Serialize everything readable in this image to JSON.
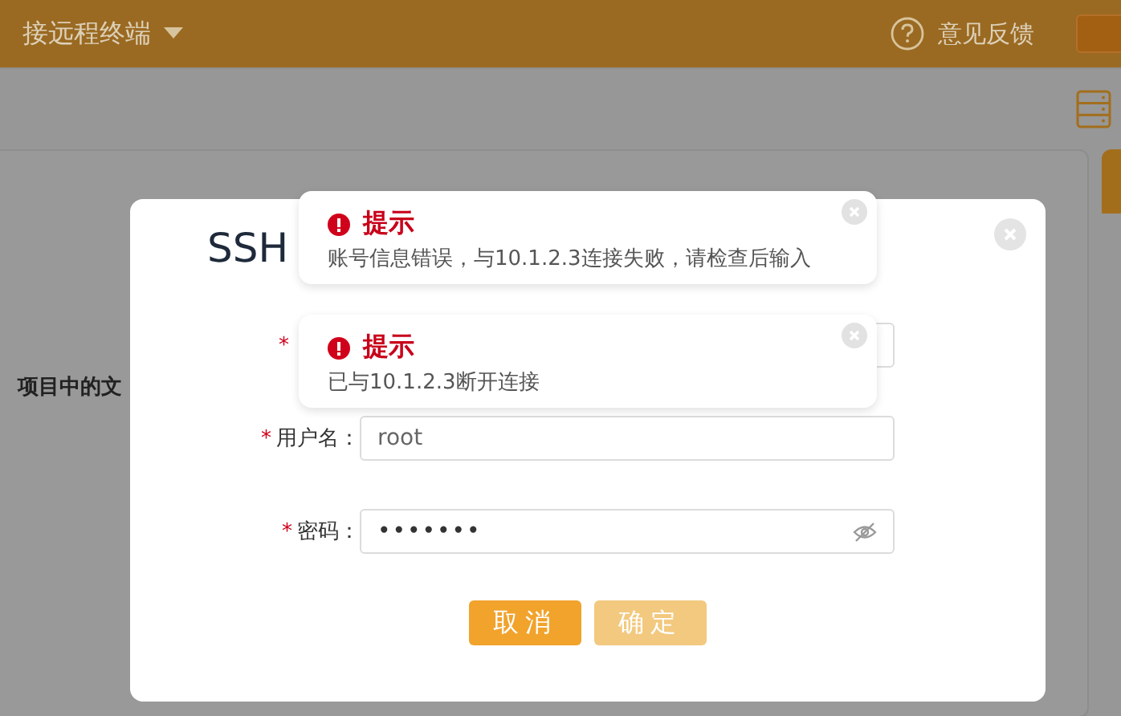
{
  "header": {
    "title": "接远程终端",
    "feedback": "意见反馈"
  },
  "background_text": "项目中的文",
  "dialog": {
    "title": "SSH",
    "rows": [
      {
        "kind": "text",
        "mark": "*"
      },
      {
        "kind": "text",
        "mark": "*",
        "label": "用户名：",
        "value": "root"
      },
      {
        "kind": "password",
        "mark": "*",
        "label": "密码：",
        "value": "•••••••"
      }
    ],
    "buttons": [
      {
        "label": "取消",
        "kind": "primary"
      },
      {
        "label": "确定",
        "kind": "secondary"
      }
    ]
  },
  "toasts": [
    {
      "title": "提示",
      "message": "账号信息错误，与10.1.2.3连接失败，请检查后输入"
    },
    {
      "title": "提示",
      "message": "已与10.1.2.3断开连接"
    }
  ]
}
